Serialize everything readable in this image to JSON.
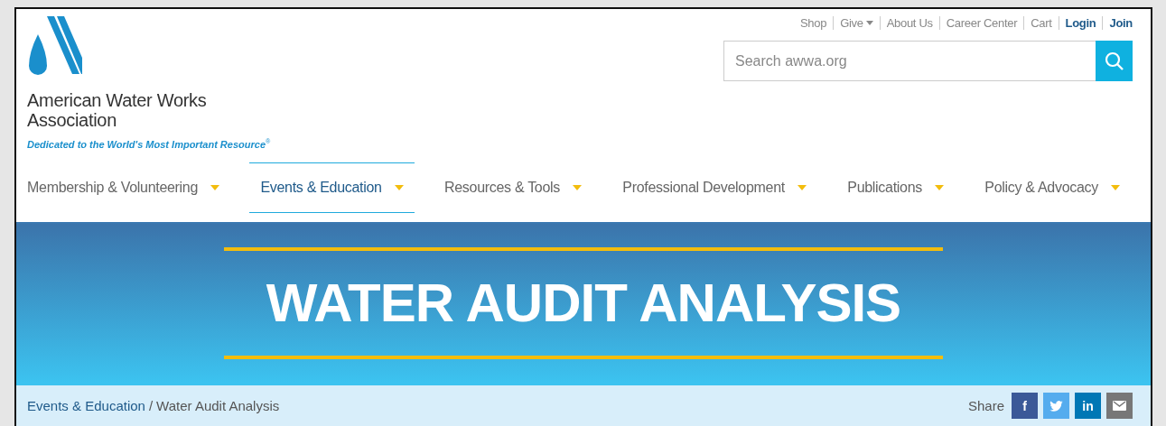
{
  "header": {
    "org_name": "American Water Works Association",
    "tagline": "Dedicated to the World's Most Important Resource",
    "tagline_mark": "®"
  },
  "utility_links": [
    {
      "label": "Shop",
      "emphasized": false,
      "dropdown": false
    },
    {
      "label": "Give",
      "emphasized": false,
      "dropdown": true
    },
    {
      "label": "About Us",
      "emphasized": false,
      "dropdown": false
    },
    {
      "label": "Career Center",
      "emphasized": false,
      "dropdown": false
    },
    {
      "label": "Cart",
      "emphasized": false,
      "dropdown": false
    },
    {
      "label": "Login",
      "emphasized": true,
      "dropdown": false
    },
    {
      "label": "Join",
      "emphasized": true,
      "dropdown": false
    }
  ],
  "search": {
    "placeholder": "Search awwa.org"
  },
  "nav": [
    {
      "label": "Membership & Volunteering",
      "selected": false
    },
    {
      "label": "Events & Education",
      "selected": true
    },
    {
      "label": "Resources & Tools",
      "selected": false
    },
    {
      "label": "Professional Development",
      "selected": false
    },
    {
      "label": "Publications",
      "selected": false
    },
    {
      "label": "Policy & Advocacy",
      "selected": false
    }
  ],
  "banner": {
    "title": "WATER AUDIT ANALYSIS"
  },
  "breadcrumb": [
    {
      "label": "Events & Education",
      "link": true
    },
    {
      "label": "Water Audit Analysis",
      "link": false
    }
  ],
  "breadcrumb_separator": "/",
  "share": {
    "label": "Share",
    "buttons": [
      {
        "kind": "facebook",
        "text": "f"
      },
      {
        "kind": "twitter"
      },
      {
        "kind": "linkedin",
        "text": "in"
      },
      {
        "kind": "email"
      }
    ]
  }
}
